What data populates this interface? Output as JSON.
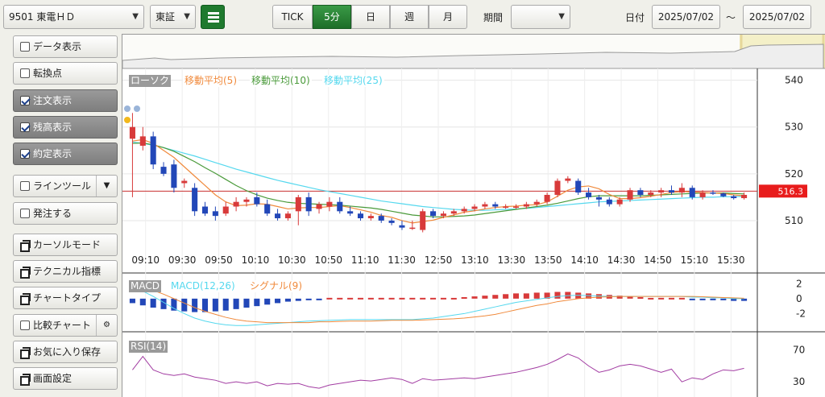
{
  "toolbar": {
    "symbol": "9501 東電ＨＤ",
    "market": "東証",
    "intervals": [
      "TICK",
      "5分",
      "日",
      "週",
      "月"
    ],
    "active_interval": "5分",
    "period_label": "期間",
    "period_value": "",
    "date_label": "日付",
    "date_from": "2025/07/02",
    "date_sep": "～",
    "date_to": "2025/07/02"
  },
  "sidebar": {
    "items": [
      {
        "label": "データ表示",
        "type": "check",
        "checked": false
      },
      {
        "label": "転換点",
        "type": "check",
        "checked": false
      },
      {
        "label": "注文表示",
        "type": "check",
        "checked": true
      },
      {
        "label": "残高表示",
        "type": "check",
        "checked": true
      },
      {
        "label": "約定表示",
        "type": "check",
        "checked": true
      },
      {
        "label": "ラインツール",
        "type": "check",
        "checked": false
      },
      {
        "label": "発注する",
        "type": "check",
        "checked": false
      },
      {
        "label": "カーソルモード",
        "type": "window"
      },
      {
        "label": "テクニカル指標",
        "type": "window"
      },
      {
        "label": "チャートタイプ",
        "type": "window"
      },
      {
        "label": "比較チャート",
        "type": "check",
        "checked": false
      },
      {
        "label": "お気に入り保存",
        "type": "window"
      },
      {
        "label": "画面設定",
        "type": "window"
      }
    ]
  },
  "legend": {
    "candle": "ローソク",
    "ma5": "移動平均(5)",
    "ma10": "移動平均(10)",
    "ma25": "移動平均(25)",
    "macd": "MACD",
    "macd_line": "MACD(12,26)",
    "signal": "シグナル(9)",
    "rsi": "RSI(14)"
  },
  "colors": {
    "up": "#d83a3a",
    "down": "#2247b8",
    "ma5": "#f08a3c",
    "ma10": "#4a9a3a",
    "ma25": "#55d8ee",
    "rsi": "#a23ca2",
    "price_tag": "#e81c1c"
  },
  "current_price": "516.3",
  "chart_data": {
    "type": "candlestick",
    "price_axis": {
      "ticks": [
        540,
        530,
        520,
        510
      ],
      "range": [
        505,
        542
      ]
    },
    "time_ticks": [
      "09:10",
      "09:30",
      "09:50",
      "10:10",
      "10:30",
      "10:50",
      "11:10",
      "11:30",
      "12:50",
      "13:10",
      "13:30",
      "13:50",
      "14:10",
      "14:30",
      "14:50",
      "15:10",
      "15:30"
    ],
    "macd_axis": {
      "ticks": [
        "2",
        "0",
        "-2"
      ],
      "range": [
        -4,
        3
      ]
    },
    "rsi_axis": {
      "ticks": [
        "70",
        "30"
      ],
      "range": [
        0,
        100
      ]
    },
    "candles": [
      {
        "o": 527.5,
        "h": 533,
        "l": 515,
        "c": 530
      },
      {
        "o": 526,
        "h": 530,
        "l": 525,
        "c": 528
      },
      {
        "o": 528,
        "h": 529,
        "l": 521,
        "c": 522
      },
      {
        "o": 521.5,
        "h": 522.5,
        "l": 519.5,
        "c": 520
      },
      {
        "o": 522,
        "h": 523,
        "l": 516,
        "c": 517
      },
      {
        "o": 518,
        "h": 519,
        "l": 517,
        "c": 518.5
      },
      {
        "o": 517,
        "h": 518,
        "l": 511,
        "c": 512
      },
      {
        "o": 513,
        "h": 514,
        "l": 511,
        "c": 511.5
      },
      {
        "o": 512,
        "h": 513,
        "l": 510,
        "c": 511
      },
      {
        "o": 511.5,
        "h": 514,
        "l": 511,
        "c": 513
      },
      {
        "o": 513,
        "h": 515,
        "l": 512,
        "c": 514
      },
      {
        "o": 514,
        "h": 515,
        "l": 513,
        "c": 514.5
      },
      {
        "o": 515,
        "h": 516,
        "l": 513,
        "c": 513.5
      },
      {
        "o": 513.5,
        "h": 514.5,
        "l": 511,
        "c": 511.5
      },
      {
        "o": 511.5,
        "h": 512.5,
        "l": 510,
        "c": 510.5
      },
      {
        "o": 510.5,
        "h": 512,
        "l": 510,
        "c": 511.5
      },
      {
        "o": 512,
        "h": 515.5,
        "l": 509,
        "c": 515
      },
      {
        "o": 515,
        "h": 516,
        "l": 511,
        "c": 512
      },
      {
        "o": 512.5,
        "h": 514,
        "l": 511.5,
        "c": 513.5
      },
      {
        "o": 513,
        "h": 515,
        "l": 512,
        "c": 514
      },
      {
        "o": 514,
        "h": 515,
        "l": 511.5,
        "c": 512
      },
      {
        "o": 512,
        "h": 513,
        "l": 511,
        "c": 511.5
      },
      {
        "o": 511.5,
        "h": 512,
        "l": 510,
        "c": 510.5
      },
      {
        "o": 510.5,
        "h": 511.5,
        "l": 510,
        "c": 511
      },
      {
        "o": 511,
        "h": 511.5,
        "l": 509.5,
        "c": 510
      },
      {
        "o": 510,
        "h": 510.5,
        "l": 509,
        "c": 509.5
      },
      {
        "o": 509,
        "h": 510,
        "l": 508,
        "c": 508.5
      },
      {
        "o": 508.5,
        "h": 510,
        "l": 508,
        "c": 508.5
      },
      {
        "o": 508,
        "h": 512.5,
        "l": 507.5,
        "c": 512
      },
      {
        "o": 512,
        "h": 512.5,
        "l": 510.5,
        "c": 511
      },
      {
        "o": 511,
        "h": 512,
        "l": 510.5,
        "c": 511.5
      },
      {
        "o": 511.5,
        "h": 512.5,
        "l": 511,
        "c": 512
      },
      {
        "o": 512,
        "h": 513,
        "l": 511.5,
        "c": 512.5
      },
      {
        "o": 512.5,
        "h": 513.5,
        "l": 512,
        "c": 513
      },
      {
        "o": 513,
        "h": 514,
        "l": 512.5,
        "c": 513.5
      },
      {
        "o": 513.5,
        "h": 514,
        "l": 512.5,
        "c": 513
      },
      {
        "o": 513,
        "h": 513.5,
        "l": 512.5,
        "c": 513
      },
      {
        "o": 513,
        "h": 513.5,
        "l": 512.5,
        "c": 513
      },
      {
        "o": 513,
        "h": 514,
        "l": 512.5,
        "c": 513.5
      },
      {
        "o": 513.5,
        "h": 514.5,
        "l": 513,
        "c": 514
      },
      {
        "o": 514,
        "h": 516,
        "l": 513.5,
        "c": 515.5
      },
      {
        "o": 515.5,
        "h": 519,
        "l": 515,
        "c": 518.5
      },
      {
        "o": 518.5,
        "h": 519.5,
        "l": 518,
        "c": 519
      },
      {
        "o": 518.5,
        "h": 519,
        "l": 515.5,
        "c": 516
      },
      {
        "o": 516,
        "h": 517,
        "l": 514.5,
        "c": 515
      },
      {
        "o": 515,
        "h": 515.5,
        "l": 513,
        "c": 514.5
      },
      {
        "o": 514.5,
        "h": 515,
        "l": 513,
        "c": 513.5
      },
      {
        "o": 513.5,
        "h": 515,
        "l": 513,
        "c": 514.5
      },
      {
        "o": 514.5,
        "h": 517,
        "l": 514,
        "c": 516.5
      },
      {
        "o": 516.5,
        "h": 517,
        "l": 515,
        "c": 515.5
      },
      {
        "o": 515.5,
        "h": 516.5,
        "l": 515,
        "c": 516
      },
      {
        "o": 516,
        "h": 517,
        "l": 515,
        "c": 516.5
      },
      {
        "o": 516.5,
        "h": 517.5,
        "l": 515.5,
        "c": 516
      },
      {
        "o": 516,
        "h": 518,
        "l": 515,
        "c": 517
      },
      {
        "o": 517,
        "h": 517.5,
        "l": 514.5,
        "c": 515
      },
      {
        "o": 515,
        "h": 516.5,
        "l": 514.5,
        "c": 516
      },
      {
        "o": 516,
        "h": 516.5,
        "l": 515.5,
        "c": 515.8
      },
      {
        "o": 515.8,
        "h": 516,
        "l": 515,
        "c": 515.2
      },
      {
        "o": 515.2,
        "h": 515.5,
        "l": 514.5,
        "c": 514.8
      },
      {
        "o": 514.8,
        "h": 516,
        "l": 514.5,
        "c": 515.5
      }
    ],
    "ma5": [
      527,
      527.3,
      526.5,
      525,
      523.5,
      521.5,
      519.5,
      517.5,
      515.5,
      514,
      513.2,
      513.3,
      513.6,
      513.5,
      513,
      512.5,
      512.7,
      512.8,
      512.8,
      513,
      513.2,
      512.8,
      512.3,
      511.8,
      511.1,
      510.7,
      510,
      509.5,
      509.8,
      510.1,
      510.7,
      511.2,
      511.8,
      512.1,
      512.5,
      512.8,
      513,
      513.1,
      513.3,
      513.4,
      514,
      515.2,
      516.5,
      517.2,
      517.4,
      516.8,
      515.6,
      514.7,
      514.7,
      514.9,
      515.2,
      515.6,
      516,
      516.2,
      516.1,
      516,
      515.9,
      515.8,
      515.5,
      515.3
    ],
    "ma10": [
      526.5,
      526.6,
      526.2,
      525.6,
      524.8,
      523.7,
      522.6,
      521.3,
      520.1,
      518.8,
      517.5,
      516.4,
      515.5,
      514.8,
      514.3,
      513.9,
      513.7,
      513.6,
      513.5,
      513.4,
      513.3,
      513.1,
      512.9,
      512.7,
      512.4,
      512,
      511.6,
      511.2,
      511,
      510.8,
      510.8,
      510.9,
      511,
      511.2,
      511.5,
      511.8,
      512.1,
      512.4,
      512.7,
      513,
      513.3,
      513.7,
      514.2,
      514.7,
      515.1,
      515.3,
      515.3,
      515.3,
      515.3,
      515.3,
      515.4,
      515.5,
      515.6,
      515.7,
      515.8,
      515.9,
      515.9,
      515.9,
      515.8,
      515.7
    ],
    "ma25": [
      526.8,
      526.5,
      526.1,
      525.6,
      525,
      524.4,
      523.8,
      523.1,
      522.4,
      521.7,
      521,
      520.4,
      519.8,
      519.2,
      518.6,
      518.1,
      517.6,
      517.1,
      516.6,
      516.2,
      515.8,
      515.4,
      515,
      514.6,
      514.2,
      513.9,
      513.6,
      513.3,
      513,
      512.8,
      512.6,
      512.4,
      512.3,
      512.2,
      512.2,
      512.3,
      512.4,
      512.5,
      512.6,
      512.8,
      513,
      513.2,
      513.4,
      513.6,
      513.8,
      514,
      514.1,
      514.2,
      514.3,
      514.4,
      514.5,
      514.6,
      514.7,
      514.8,
      514.9,
      515,
      515,
      515.1,
      515.1,
      515.2
    ],
    "macd_hist": [
      -0.6,
      -0.9,
      -1.2,
      -1.4,
      -1.6,
      -1.7,
      -1.8,
      -1.8,
      -1.7,
      -1.6,
      -1.4,
      -1.2,
      -1,
      -0.8,
      -0.6,
      -0.4,
      -0.3,
      -0.2,
      -0.1,
      0,
      0,
      0,
      0,
      0,
      0,
      0,
      0,
      0,
      0,
      0,
      0,
      0.1,
      0.2,
      0.3,
      0.4,
      0.5,
      0.6,
      0.7,
      0.7,
      0.8,
      0.8,
      0.9,
      0.9,
      0.8,
      0.7,
      0.6,
      0.5,
      0.4,
      0.3,
      0.2,
      0.1,
      0,
      0,
      0,
      -0.1,
      -0.1,
      -0.2,
      -0.2,
      -0.3,
      -0.3
    ],
    "macd_line": [
      1.5,
      1,
      0.3,
      -0.5,
      -1.3,
      -2,
      -2.6,
      -3,
      -3.3,
      -3.5,
      -3.6,
      -3.6,
      -3.5,
      -3.4,
      -3.3,
      -3.2,
      -3.1,
      -3,
      -2.95,
      -2.9,
      -2.85,
      -2.8,
      -2.8,
      -2.8,
      -2.8,
      -2.8,
      -2.8,
      -2.8,
      -2.7,
      -2.6,
      -2.4,
      -2.2,
      -2,
      -1.7,
      -1.4,
      -1.1,
      -0.8,
      -0.5,
      -0.3,
      -0.1,
      0.1,
      0.3,
      0.4,
      0.45,
      0.4,
      0.35,
      0.3,
      0.3,
      0.3,
      0.3,
      0.3,
      0.3,
      0.3,
      0.3,
      0.2,
      0.2,
      0.1,
      0.1,
      0,
      0
    ],
    "signal_line": [
      1.8,
      1.5,
      1.1,
      0.6,
      0,
      -0.6,
      -1.2,
      -1.7,
      -2.1,
      -2.5,
      -2.8,
      -3,
      -3.1,
      -3.2,
      -3.2,
      -3.2,
      -3.2,
      -3.2,
      -3.1,
      -3.1,
      -3.05,
      -3,
      -3,
      -3,
      -2.95,
      -2.9,
      -2.9,
      -2.9,
      -2.85,
      -2.8,
      -2.75,
      -2.7,
      -2.6,
      -2.45,
      -2.3,
      -2.1,
      -1.8,
      -1.5,
      -1.2,
      -0.9,
      -0.7,
      -0.4,
      -0.2,
      0,
      0.1,
      0.2,
      0.25,
      0.3,
      0.3,
      0.3,
      0.3,
      0.3,
      0.3,
      0.3,
      0.3,
      0.25,
      0.2,
      0.15,
      0.1,
      0.05
    ],
    "rsi": [
      45,
      62,
      45,
      40,
      38,
      40,
      36,
      34,
      32,
      28,
      30,
      28,
      30,
      25,
      28,
      27,
      28,
      24,
      22,
      26,
      28,
      30,
      32,
      31,
      33,
      35,
      33,
      28,
      34,
      32,
      33,
      34,
      35,
      34,
      36,
      38,
      40,
      42,
      45,
      48,
      52,
      58,
      65,
      60,
      50,
      42,
      45,
      50,
      52,
      50,
      46,
      42,
      46,
      30,
      35,
      33,
      40,
      45,
      44,
      47
    ]
  }
}
